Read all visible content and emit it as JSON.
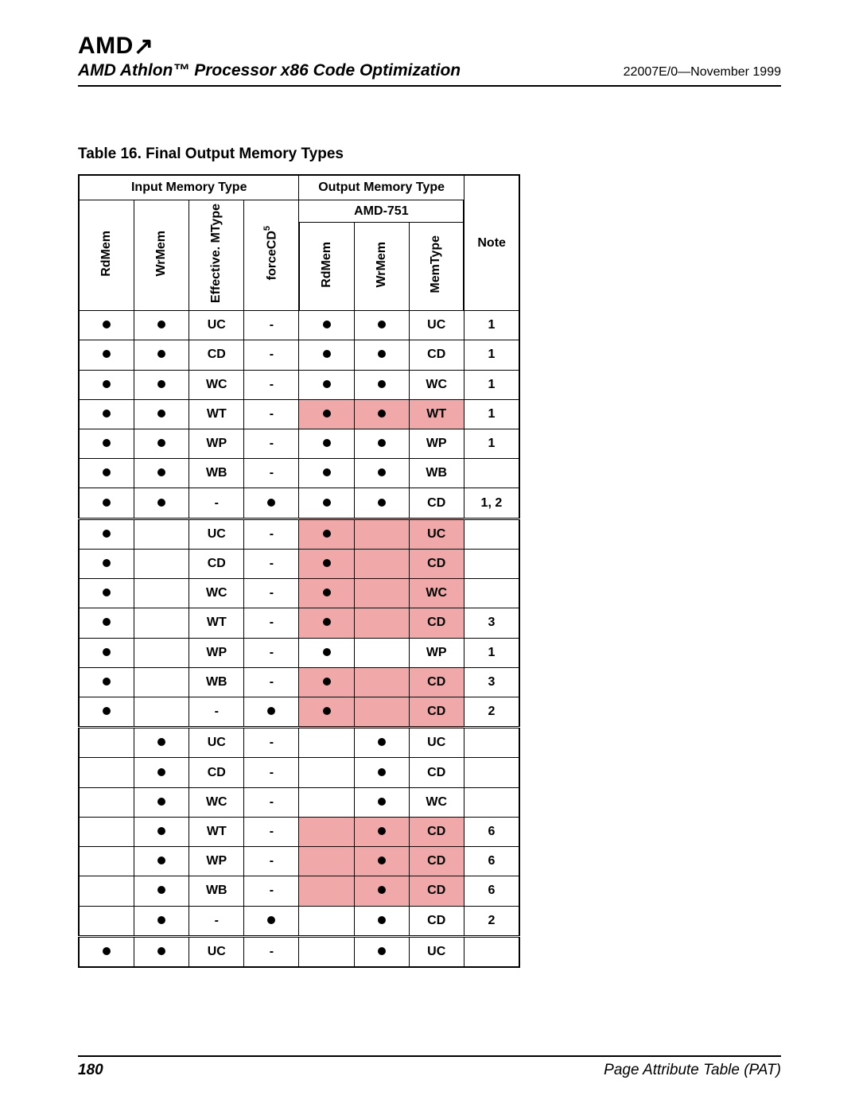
{
  "header": {
    "logo_text": "AMD",
    "doc_title": "AMD Athlon™ Processor x86 Code Optimization",
    "doc_rev": "22007E/0—November 1999"
  },
  "caption": "Table 16.   Final Output Memory Types",
  "columns": {
    "input_group": "Input Memory Type",
    "output_group": "Output Memory Type",
    "amd751": "AMD-751",
    "note": "Note",
    "rdmem": "RdMem",
    "wrmem": "WrMem",
    "eff_mtype": "Effective. MType",
    "forcecd": "forceCD",
    "forcecd_sup": "5",
    "out_rdmem": "RdMem",
    "out_wrmem": "WrMem",
    "memtype": "MemType"
  },
  "rows": [
    {
      "g": 0,
      "in_rd": "dot",
      "in_wr": "dot",
      "eff": "UC",
      "fcd": "-",
      "o_rd": "dot",
      "o_wr": "dot",
      "mt": "UC",
      "note": "1",
      "hl": []
    },
    {
      "g": 0,
      "in_rd": "dot",
      "in_wr": "dot",
      "eff": "CD",
      "fcd": "-",
      "o_rd": "dot",
      "o_wr": "dot",
      "mt": "CD",
      "note": "1",
      "hl": []
    },
    {
      "g": 0,
      "in_rd": "dot",
      "in_wr": "dot",
      "eff": "WC",
      "fcd": "-",
      "o_rd": "dot",
      "o_wr": "dot",
      "mt": "WC",
      "note": "1",
      "hl": []
    },
    {
      "g": 0,
      "in_rd": "dot",
      "in_wr": "dot",
      "eff": "WT",
      "fcd": "-",
      "o_rd": "dot",
      "o_wr": "dot",
      "mt": "WT",
      "note": "1",
      "hl": [
        "o_rd",
        "o_wr",
        "mt"
      ]
    },
    {
      "g": 0,
      "in_rd": "dot",
      "in_wr": "dot",
      "eff": "WP",
      "fcd": "-",
      "o_rd": "dot",
      "o_wr": "dot",
      "mt": "WP",
      "note": "1",
      "hl": []
    },
    {
      "g": 0,
      "in_rd": "dot",
      "in_wr": "dot",
      "eff": "WB",
      "fcd": "-",
      "o_rd": "dot",
      "o_wr": "dot",
      "mt": "WB",
      "note": "",
      "hl": []
    },
    {
      "g": 0,
      "in_rd": "dot",
      "in_wr": "dot",
      "eff": "-",
      "fcd": "dot",
      "o_rd": "dot",
      "o_wr": "dot",
      "mt": "CD",
      "note": "1, 2",
      "hl": []
    },
    {
      "g": 1,
      "in_rd": "dot",
      "in_wr": "",
      "eff": "UC",
      "fcd": "-",
      "o_rd": "dot",
      "o_wr": "",
      "mt": "UC",
      "note": "",
      "hl": [
        "o_rd",
        "o_wr",
        "mt"
      ]
    },
    {
      "g": 1,
      "in_rd": "dot",
      "in_wr": "",
      "eff": "CD",
      "fcd": "-",
      "o_rd": "dot",
      "o_wr": "",
      "mt": "CD",
      "note": "",
      "hl": [
        "o_rd",
        "o_wr",
        "mt"
      ]
    },
    {
      "g": 1,
      "in_rd": "dot",
      "in_wr": "",
      "eff": "WC",
      "fcd": "-",
      "o_rd": "dot",
      "o_wr": "",
      "mt": "WC",
      "note": "",
      "hl": [
        "o_rd",
        "o_wr",
        "mt"
      ]
    },
    {
      "g": 1,
      "in_rd": "dot",
      "in_wr": "",
      "eff": "WT",
      "fcd": "-",
      "o_rd": "dot",
      "o_wr": "",
      "mt": "CD",
      "note": "3",
      "hl": [
        "o_rd",
        "o_wr",
        "mt"
      ]
    },
    {
      "g": 1,
      "in_rd": "dot",
      "in_wr": "",
      "eff": "WP",
      "fcd": "-",
      "o_rd": "dot",
      "o_wr": "",
      "mt": "WP",
      "note": "1",
      "hl": []
    },
    {
      "g": 1,
      "in_rd": "dot",
      "in_wr": "",
      "eff": "WB",
      "fcd": "-",
      "o_rd": "dot",
      "o_wr": "",
      "mt": "CD",
      "note": "3",
      "hl": [
        "o_rd",
        "o_wr",
        "mt"
      ]
    },
    {
      "g": 1,
      "in_rd": "dot",
      "in_wr": "",
      "eff": "-",
      "fcd": "dot",
      "o_rd": "dot",
      "o_wr": "",
      "mt": "CD",
      "note": "2",
      "hl": [
        "o_rd",
        "o_wr",
        "mt"
      ]
    },
    {
      "g": 2,
      "in_rd": "",
      "in_wr": "dot",
      "eff": "UC",
      "fcd": "-",
      "o_rd": "",
      "o_wr": "dot",
      "mt": "UC",
      "note": "",
      "hl": []
    },
    {
      "g": 2,
      "in_rd": "",
      "in_wr": "dot",
      "eff": "CD",
      "fcd": "-",
      "o_rd": "",
      "o_wr": "dot",
      "mt": "CD",
      "note": "",
      "hl": []
    },
    {
      "g": 2,
      "in_rd": "",
      "in_wr": "dot",
      "eff": "WC",
      "fcd": "-",
      "o_rd": "",
      "o_wr": "dot",
      "mt": "WC",
      "note": "",
      "hl": []
    },
    {
      "g": 2,
      "in_rd": "",
      "in_wr": "dot",
      "eff": "WT",
      "fcd": "-",
      "o_rd": "",
      "o_wr": "dot",
      "mt": "CD",
      "note": "6",
      "hl": [
        "o_rd",
        "o_wr",
        "mt"
      ]
    },
    {
      "g": 2,
      "in_rd": "",
      "in_wr": "dot",
      "eff": "WP",
      "fcd": "-",
      "o_rd": "",
      "o_wr": "dot",
      "mt": "CD",
      "note": "6",
      "hl": [
        "o_rd",
        "o_wr",
        "mt"
      ]
    },
    {
      "g": 2,
      "in_rd": "",
      "in_wr": "dot",
      "eff": "WB",
      "fcd": "-",
      "o_rd": "",
      "o_wr": "dot",
      "mt": "CD",
      "note": "6",
      "hl": [
        "o_rd",
        "o_wr",
        "mt"
      ]
    },
    {
      "g": 2,
      "in_rd": "",
      "in_wr": "dot",
      "eff": "-",
      "fcd": "dot",
      "o_rd": "",
      "o_wr": "dot",
      "mt": "CD",
      "note": "2",
      "hl": []
    },
    {
      "g": 3,
      "in_rd": "dot",
      "in_wr": "dot",
      "eff": "UC",
      "fcd": "-",
      "o_rd": "",
      "o_wr": "dot",
      "mt": "UC",
      "note": "",
      "hl": []
    }
  ],
  "footer": {
    "page": "180",
    "right": "Page Attribute Table (PAT)"
  }
}
